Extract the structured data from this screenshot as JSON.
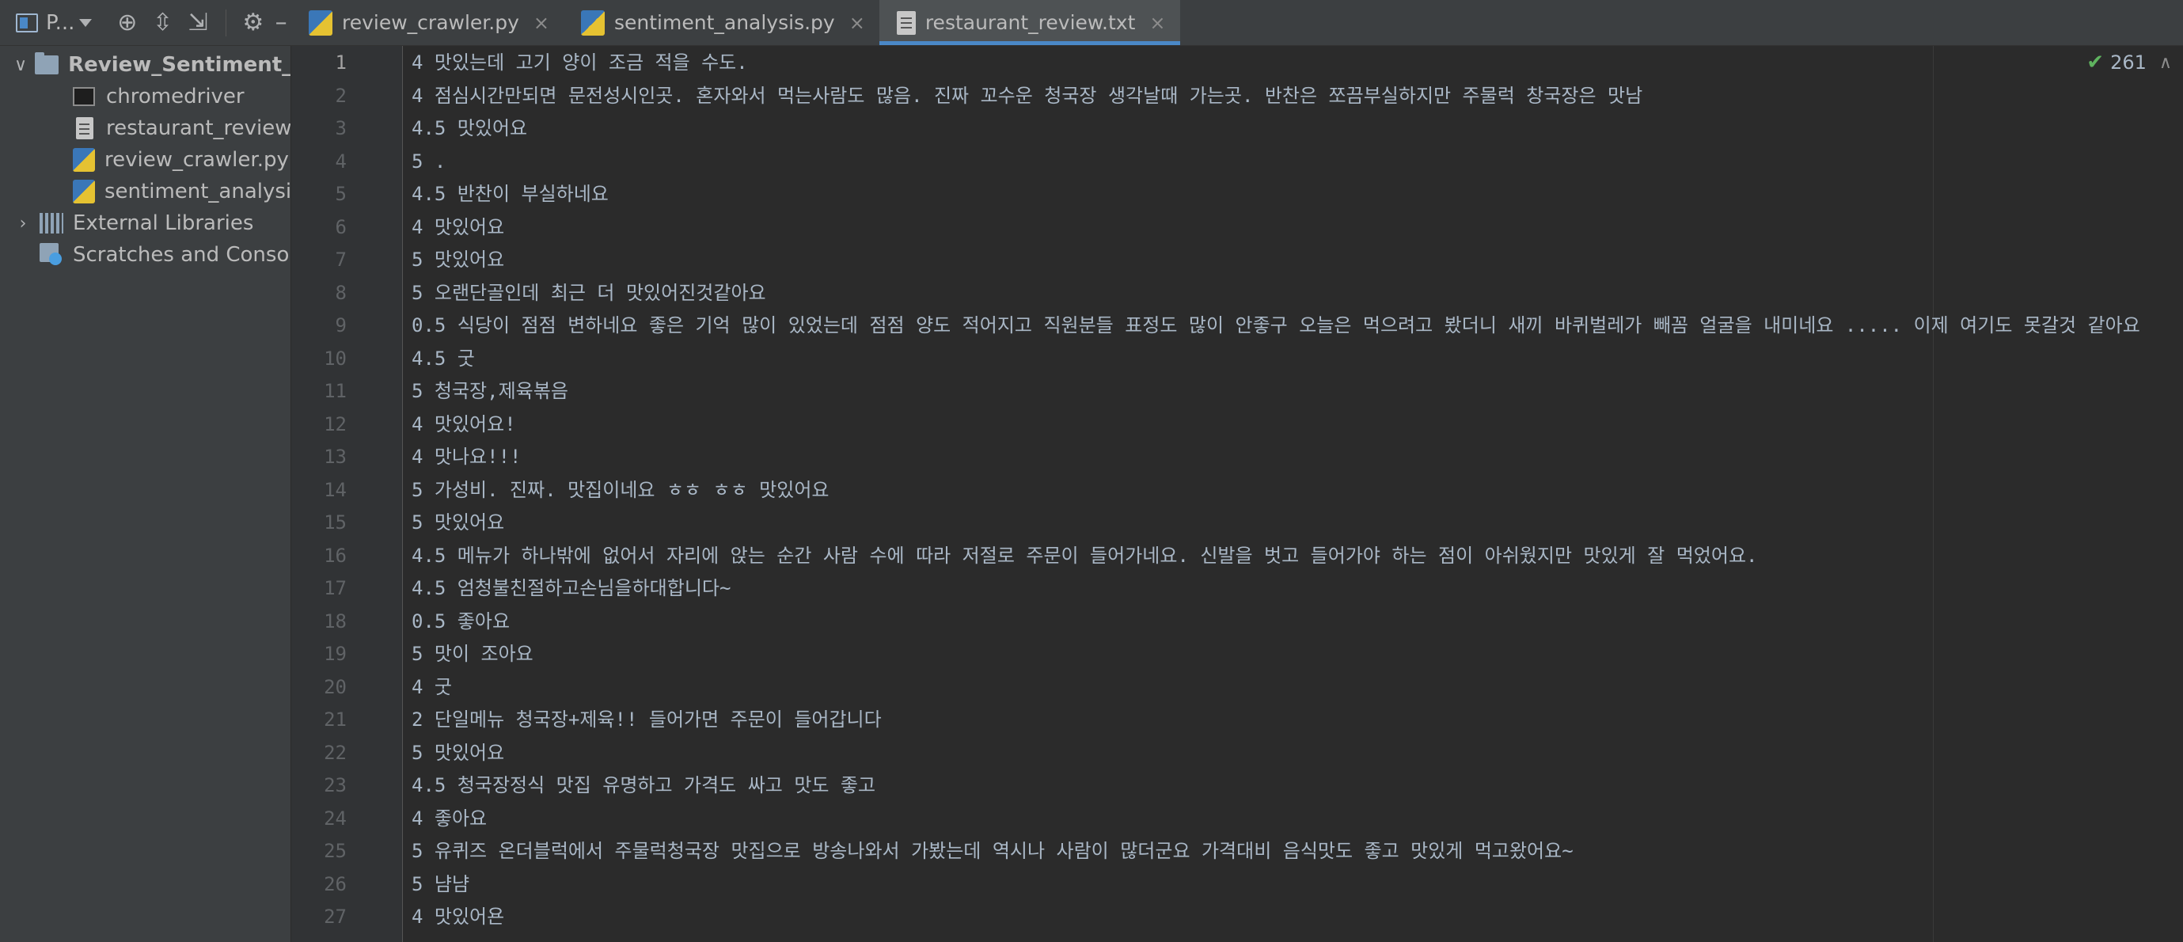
{
  "project_panel": {
    "title": "P...",
    "tree": [
      {
        "label": "Review_Sentiment_A",
        "kind": "folder",
        "expanded": "∨"
      },
      {
        "label": "chromedriver",
        "kind": "binary"
      },
      {
        "label": "restaurant_review.t",
        "kind": "txt"
      },
      {
        "label": "review_crawler.py",
        "kind": "py"
      },
      {
        "label": "sentiment_analysis",
        "kind": "py"
      },
      {
        "label": "External Libraries",
        "kind": "libraries",
        "expanded": "›"
      },
      {
        "label": "Scratches and Console",
        "kind": "scratches"
      }
    ]
  },
  "tabs": [
    {
      "label": "review_crawler.py",
      "icon": "python-file-icon",
      "close": "×"
    },
    {
      "label": "sentiment_analysis.py",
      "icon": "python-file-icon",
      "close": "×"
    },
    {
      "label": "restaurant_review.txt",
      "icon": "text-file-icon",
      "close": "×",
      "active": true
    }
  ],
  "editor": {
    "inspection_count": "261",
    "lines": [
      {
        "n": "1",
        "text": "4    맛있는데 고기 양이 조금 적을 수도."
      },
      {
        "n": "2",
        "text": "4    점심시간만되면 문전성시인곳. 혼자와서 먹는사람도 많음. 진짜 꼬수운 청국장 생각날때 가는곳. 반찬은 쪼끔부실하지만 주물럭 창국장은 맛남"
      },
      {
        "n": "3",
        "text": "4.5  맛있어요"
      },
      {
        "n": "4",
        "text": "5    ."
      },
      {
        "n": "5",
        "text": "4.5  반찬이 부실하네요"
      },
      {
        "n": "6",
        "text": "4    맛있어요"
      },
      {
        "n": "7",
        "text": "5    맛있어요"
      },
      {
        "n": "8",
        "text": "5    오랜단골인데 최근 더 맛있어진것같아요"
      },
      {
        "n": "9",
        "text": "0.5  식당이 점점 변하네요 좋은 기억 많이 있었는데 점점 양도 적어지고 직원분들 표정도 많이 안좋구 오늘은 먹으려고 봤더니 새끼 바퀴벌레가 빼꼼 얼굴을 내미네요 ..... 이제 여기도 못갈것 같아요"
      },
      {
        "n": "10",
        "text": "4.5  굿"
      },
      {
        "n": "11",
        "text": "5    청국장,제육볶음"
      },
      {
        "n": "12",
        "text": "4    맛있어요!"
      },
      {
        "n": "13",
        "text": "4    맛나요!!!"
      },
      {
        "n": "14",
        "text": "5    가성비. 진짜. 맛집이네요 ㅎㅎ ㅎㅎ 맛있어요"
      },
      {
        "n": "15",
        "text": "5    맛있어요"
      },
      {
        "n": "16",
        "text": "4.5  메뉴가 하나밖에 없어서 자리에 앉는 순간 사람 수에 따라 저절로 주문이 들어가네요. 신발을 벗고 들어가야 하는 점이 아쉬웠지만 맛있게 잘 먹었어요."
      },
      {
        "n": "17",
        "text": "4.5  엄청불친절하고손님을하대합니다~"
      },
      {
        "n": "18",
        "text": "0.5  좋아요"
      },
      {
        "n": "19",
        "text": "5    맛이 조아요"
      },
      {
        "n": "20",
        "text": "4    굿"
      },
      {
        "n": "21",
        "text": "2    단일메뉴 청국장+제육!! 들어가면 주문이 들어갑니다"
      },
      {
        "n": "22",
        "text": "5    맛있어요"
      },
      {
        "n": "23",
        "text": "4.5  청국장정식 맛집 유명하고 가격도 싸고 맛도 좋고"
      },
      {
        "n": "24",
        "text": "4    좋아요"
      },
      {
        "n": "25",
        "text": "5    유퀴즈 온더블럭에서 주물럭청국장 맛집으로 방송나와서 가봤는데 역시나 사람이 많더군요 가격대비 음식맛도 좋고 맛있게 먹고왔어요~"
      },
      {
        "n": "26",
        "text": "5    냠냠"
      },
      {
        "n": "27",
        "text": "4    맛있어욘"
      }
    ]
  }
}
